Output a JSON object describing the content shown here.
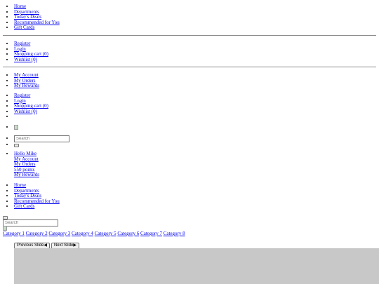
{
  "main_nav": [
    "Home",
    "Departments",
    "Today's Deals",
    "Recommended for You",
    "Gift Cards"
  ],
  "account_links_1": [
    "Register",
    "Login",
    "Shopping cart (0)",
    "Wishlist (0)"
  ],
  "account_menu": [
    "My Account",
    "My Orders",
    "My Rewards"
  ],
  "account_links_2": [
    "Register",
    "Login",
    "Shopping cart (0)",
    "Wishlist (0)"
  ],
  "search": {
    "placeholder": "Search"
  },
  "user_menu": [
    "Hello Mike",
    "My Account",
    "My Orders",
    "550 points",
    "My Rewards"
  ],
  "main_nav_2": [
    "Home",
    "Departments",
    "Today's Deals",
    "Recommended for You",
    "Gift Cards"
  ],
  "search_2": {
    "placeholder": "Search"
  },
  "categories": [
    "Category 1",
    "Category 2",
    "Category 3",
    "Category 4",
    "Category 5",
    "Category 6",
    "Category 7",
    "Category 8"
  ],
  "slider": {
    "prev_label": "Previous Slide◀",
    "next_label": "Next Slide▶"
  },
  "icons": {
    "logo": "broken-image-icon",
    "banner": "broken-image-icon"
  }
}
